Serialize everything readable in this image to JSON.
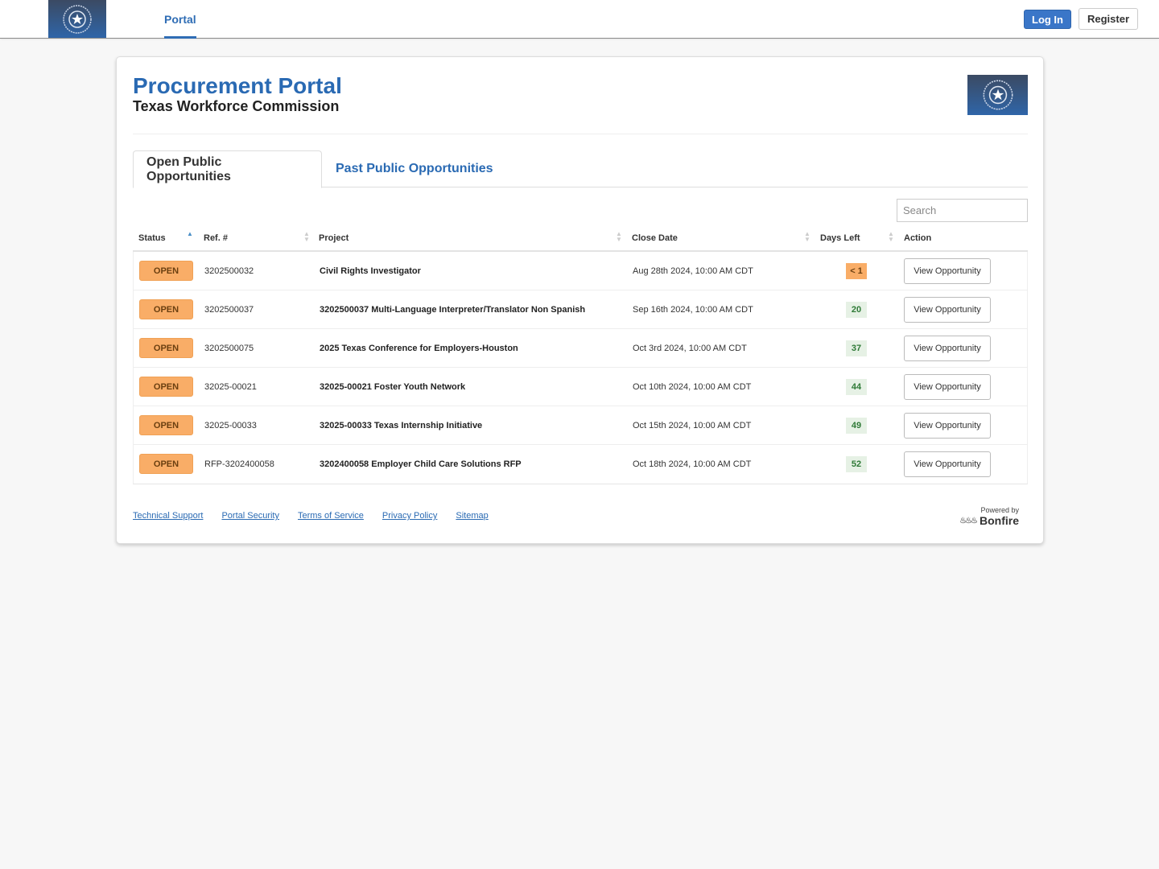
{
  "navbar": {
    "logo_alt": "Texas Workforce Commission seal",
    "tab_label": "Portal",
    "login_label": "Log In",
    "register_label": "Register"
  },
  "header": {
    "title": "Procurement Portal",
    "subtitle": "Texas Workforce Commission"
  },
  "tabs": [
    {
      "label": "Open Public Opportunities",
      "active": true
    },
    {
      "label": "Past Public Opportunities",
      "active": false
    }
  ],
  "search": {
    "placeholder": "Search",
    "value": ""
  },
  "table": {
    "columns": [
      "Status",
      "Ref. #",
      "Project",
      "Close Date",
      "Days Left",
      "Action"
    ],
    "sorted_column": "Status",
    "sort_direction": "ascending",
    "rows": [
      {
        "status": "OPEN",
        "ref": "3202500032",
        "project": "Civil Rights Investigator",
        "close_date": "Aug 28th 2024, 10:00 AM CDT",
        "days_left": "< 1",
        "urgent": true,
        "action": "View Opportunity"
      },
      {
        "status": "OPEN",
        "ref": "3202500037",
        "project": "3202500037 Multi-Language Interpreter/Translator Non Spanish",
        "close_date": "Sep 16th 2024, 10:00 AM CDT",
        "days_left": "20",
        "urgent": false,
        "action": "View Opportunity"
      },
      {
        "status": "OPEN",
        "ref": "3202500075",
        "project": "2025 Texas Conference for Employers-Houston",
        "close_date": "Oct 3rd 2024, 10:00 AM CDT",
        "days_left": "37",
        "urgent": false,
        "action": "View Opportunity"
      },
      {
        "status": "OPEN",
        "ref": "32025-00021",
        "project": "32025-00021 Foster Youth Network",
        "close_date": "Oct 10th 2024, 10:00 AM CDT",
        "days_left": "44",
        "urgent": false,
        "action": "View Opportunity"
      },
      {
        "status": "OPEN",
        "ref": "32025-00033",
        "project": "32025-00033 Texas Internship Initiative",
        "close_date": "Oct 15th 2024, 10:00 AM CDT",
        "days_left": "49",
        "urgent": false,
        "action": "View Opportunity"
      },
      {
        "status": "OPEN",
        "ref": "RFP-3202400058",
        "project": "3202400058 Employer Child Care Solutions RFP",
        "close_date": "Oct 18th 2024, 10:00 AM CDT",
        "days_left": "52",
        "urgent": false,
        "action": "View Opportunity"
      }
    ]
  },
  "footer": {
    "links": [
      "Technical Support",
      "Portal Security",
      "Terms of Service",
      "Privacy Policy",
      "Sitemap"
    ],
    "powered_by": "Powered by",
    "brand": "Bonfire"
  },
  "colors": {
    "brand_blue": "#2a6ab3",
    "login_blue": "#3a76c8",
    "open_orange": "#f9ad67",
    "ok_green_bg": "#e6f1e5",
    "ok_green_text": "#2f7a37"
  }
}
